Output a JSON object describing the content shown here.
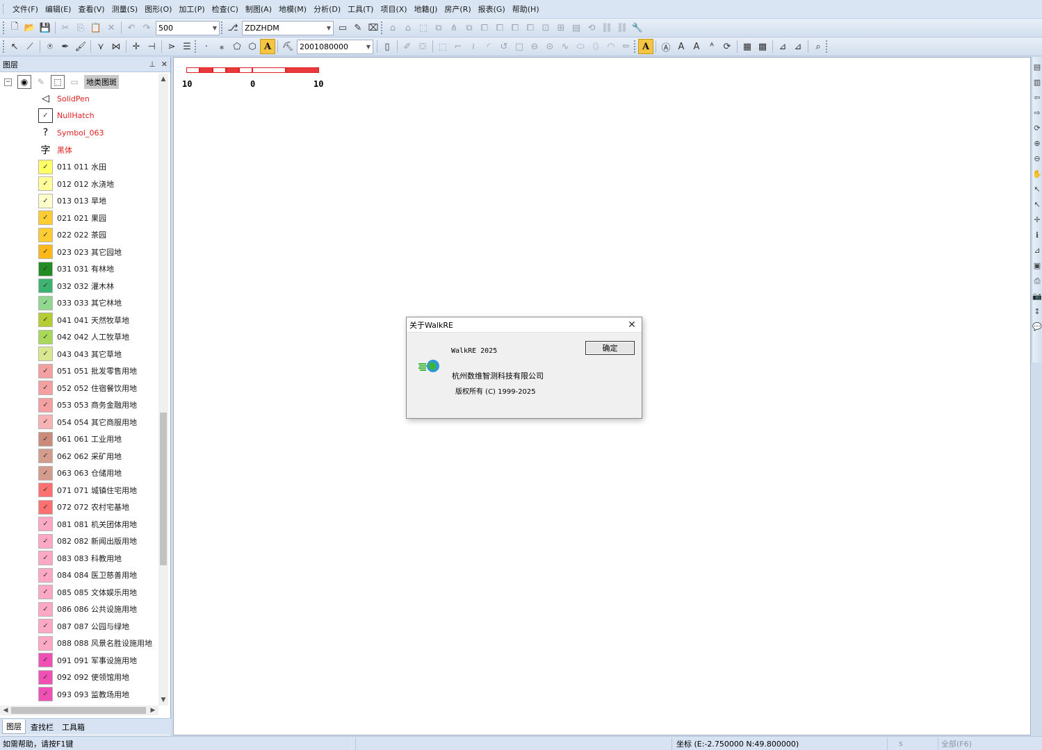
{
  "menu": [
    "文件(F)",
    "编辑(E)",
    "查看(V)",
    "测量(S)",
    "图形(O)",
    "加工(P)",
    "检查(C)",
    "制图(A)",
    "地模(M)",
    "分析(D)",
    "工具(T)",
    "项目(X)",
    "地籍(J)",
    "房产(R)",
    "报表(G)",
    "帮助(H)"
  ],
  "toolbar1": {
    "scale_value": "500",
    "layer_code_value": "ZDZHDM"
  },
  "toolbar2": {
    "code_value": "2001080000"
  },
  "layer_panel": {
    "title": "图层",
    "pin_icon": "pin-icon",
    "close_icon": "close-icon",
    "root_label": "地类图斑",
    "style_items": [
      {
        "icon": "pen-icon",
        "label": "SolidPen"
      },
      {
        "icon": "hatch-icon",
        "label": "NullHatch"
      },
      {
        "icon": "question-icon",
        "label": "Symbol_063"
      },
      {
        "icon": "font-icon",
        "label": "黑体"
      }
    ],
    "items": [
      {
        "label": "011 011 水田",
        "color": "#ffff66"
      },
      {
        "label": "012 012 水浇地",
        "color": "#ffff99"
      },
      {
        "label": "013 013 旱地",
        "color": "#ffffcc"
      },
      {
        "label": "021 021 果园",
        "color": "#ffcc33"
      },
      {
        "label": "022 022 茶园",
        "color": "#ffcc33"
      },
      {
        "label": "023 023 其它园地",
        "color": "#ffb81a"
      },
      {
        "label": "031 031 有林地",
        "color": "#228b22"
      },
      {
        "label": "032 032 灌木林",
        "color": "#3cb371"
      },
      {
        "label": "033 033 其它林地",
        "color": "#90d890"
      },
      {
        "label": "041 041 天然牧草地",
        "color": "#b5cc33"
      },
      {
        "label": "042 042 人工牧草地",
        "color": "#a8d85a"
      },
      {
        "label": "043 043 其它草地",
        "color": "#d8e890"
      },
      {
        "label": "051 051 批发零售用地",
        "color": "#f4a0a0"
      },
      {
        "label": "052 052 住宿餐饮用地",
        "color": "#f4a0a0"
      },
      {
        "label": "053 053 商务金融用地",
        "color": "#f4a0a0"
      },
      {
        "label": "054 054 其它商服用地",
        "color": "#f7b3b3"
      },
      {
        "label": "061 061 工业用地",
        "color": "#cc8a7a"
      },
      {
        "label": "062 062 采矿用地",
        "color": "#d49c8c"
      },
      {
        "label": "063 063 仓储用地",
        "color": "#d49c8c"
      },
      {
        "label": "071 071 城镇住宅用地",
        "color": "#ff7070"
      },
      {
        "label": "072 072 农村宅基地",
        "color": "#ff7070"
      },
      {
        "label": "081 081 机关团体用地",
        "color": "#ffa8c4"
      },
      {
        "label": "082 082 新闻出版用地",
        "color": "#ffa8c4"
      },
      {
        "label": "083 083 科教用地",
        "color": "#ffa8c4"
      },
      {
        "label": "084 084 医卫慈善用地",
        "color": "#ffa8c4"
      },
      {
        "label": "085 085 文体娱乐用地",
        "color": "#ffa8c4"
      },
      {
        "label": "086 086 公共设施用地",
        "color": "#ffa8c4"
      },
      {
        "label": "087 087 公园与绿地",
        "color": "#ffa8c4"
      },
      {
        "label": "088 088 风景名胜设施用地",
        "color": "#ffa8c4"
      },
      {
        "label": "091 091 军事设施用地",
        "color": "#f050b4"
      },
      {
        "label": "092 092 使领馆用地",
        "color": "#f050b4"
      },
      {
        "label": "093 093 监教场用地",
        "color": "#f050b4"
      }
    ],
    "tabs": [
      "图层",
      "查找栏",
      "工具箱"
    ]
  },
  "scale_bar": {
    "labels": [
      "10",
      "0",
      "10"
    ],
    "color": "#e02020"
  },
  "about_dialog": {
    "title": "关于WalkRE",
    "version": "WalkRE 2025",
    "company": "杭州数维智测科技有限公司",
    "copyright": "版权所有 (C) 1999-2025",
    "ok_label": "确定"
  },
  "statusbar": {
    "help": "如需帮助，请按F1键",
    "coordinates": "坐标 (E:-2.750000  N:49.800000)",
    "indicator": "s",
    "view_all": "全部(F6)"
  }
}
